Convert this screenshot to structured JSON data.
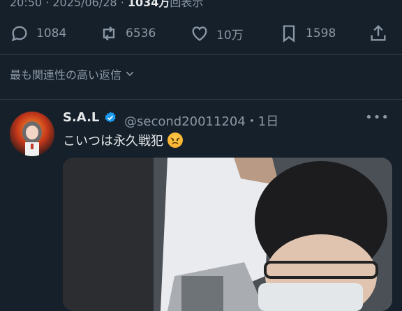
{
  "meta": {
    "time": "20:50",
    "date": "2025/06/28",
    "views_count": "1034万",
    "views_suffix": "回表示"
  },
  "actions": {
    "replies": "1084",
    "retweets": "6536",
    "likes": "10万",
    "bookmarks": "1598"
  },
  "sort": {
    "label": "最も関連性の高い返信"
  },
  "reply": {
    "display_name": "S.A.L",
    "handle_time": "@second20011204・1日",
    "more": "•••",
    "text": "こいつは永久戦犯"
  },
  "colors": {
    "background": "#15202b",
    "muted": "#8b98a5",
    "text": "#e7e9ea",
    "verified": "#1d9bf0"
  }
}
